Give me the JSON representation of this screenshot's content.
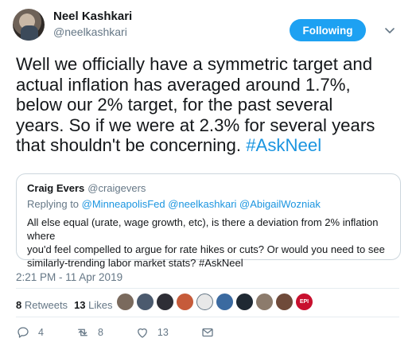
{
  "author": {
    "name": "Neel Kashkari",
    "handle": "@neelkashkari"
  },
  "follow_button": {
    "label": "Following"
  },
  "tweet": {
    "text": "Well we officially have a symmetric target and\nactual inflation has averaged around 1.7%,\nbelow our 2% target, for the past several\nyears.  So if we were at 2.3% for several years\nthat shouldn't be concerning. ",
    "hashtag": "#AskNeel"
  },
  "quoted_tweet": {
    "name": "Craig Evers",
    "handle": "@craigevers",
    "replying_prefix": "Replying to ",
    "replying_to": "@MinneapolisFed @neelkashkari @AbigailWozniak",
    "body": "All else equal (urate, wage growth, etc), is there a deviation from 2% inflation where\nyou'd feel compelled to argue for rate hikes or cuts? Or would you need to see\nsimilarly-trending labor market stats? #AskNeel"
  },
  "timestamp": "2:21 PM - 11 Apr 2019",
  "stats": {
    "retweets_count": "8",
    "retweets_label": "Retweets",
    "likes_count": "13",
    "likes_label": "Likes"
  },
  "liker_avatars": [
    {
      "color": "#7a6a5d"
    },
    {
      "color": "#4b5a6e"
    },
    {
      "color": "#2e2e36"
    },
    {
      "color": "#c65b3a"
    },
    {
      "color": "#e8e8e8"
    },
    {
      "color": "#3b6aa0"
    },
    {
      "color": "#1f2933"
    },
    {
      "color": "#8c7b6c"
    },
    {
      "color": "#6f4a3a"
    },
    {
      "color": "#c8102e",
      "text": "EPI"
    }
  ],
  "actions": {
    "reply_count": "4",
    "retweet_count": "8",
    "like_count": "13"
  },
  "colors": {
    "accent": "#1da1f2",
    "link": "#1b95e0",
    "muted": "#657786",
    "retweet_green": "#17bf63"
  },
  "icons": [
    "reply-icon",
    "retweet-icon",
    "heart-icon",
    "message-icon",
    "chevron-down-icon"
  ]
}
